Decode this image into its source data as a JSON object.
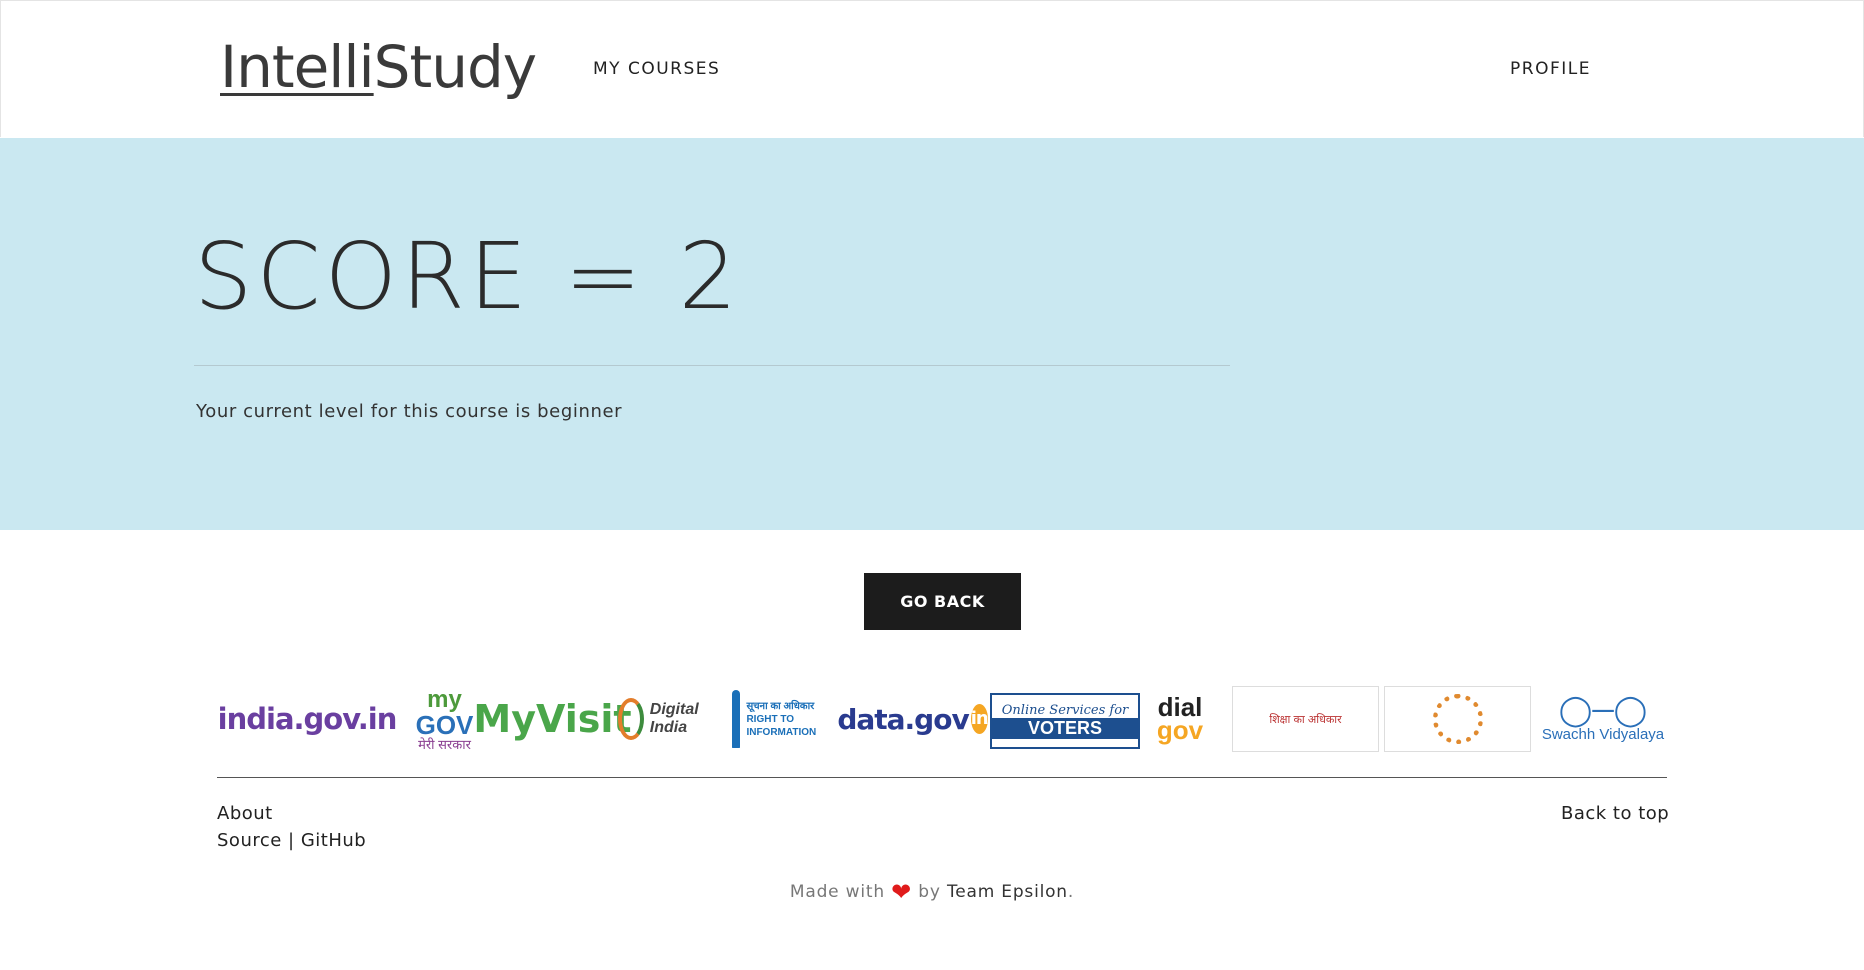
{
  "nav": {
    "brand_left": "Intelli",
    "brand_right": "Study",
    "my_courses": "MY COURSES",
    "profile": "PROFILE"
  },
  "hero": {
    "score": "SCORE = 2",
    "level_text": "Your current level for this course is beginner",
    "background": "#cae8f1"
  },
  "actions": {
    "go_back": "GO BACK"
  },
  "logos": {
    "india": "india.gov.in",
    "mygov_a": "my",
    "mygov_b": "GOV",
    "mygov_c": "मेरी सरकार",
    "myvisit": "MyVisit",
    "digital_india": "Digital India",
    "rti": "सूचना का अधिकार RIGHT TO INFORMATION",
    "datagov": "data.gov",
    "datagov_in": "in",
    "voters_top": "Online Services for",
    "voters_main": "VOTERS",
    "dial": "dial",
    "dial_gov": "gov",
    "rte": "शिक्षा का अधिकार",
    "swachh_glasses": "◯─◯",
    "swachh": "Swachh Vidyalaya"
  },
  "footer": {
    "about": "About",
    "source": "Source | GitHub",
    "back_to_top": "Back to top",
    "made_with": "Made with",
    "heart": "❤",
    "by": "by",
    "team": "Team Epsilon",
    "period": "."
  }
}
